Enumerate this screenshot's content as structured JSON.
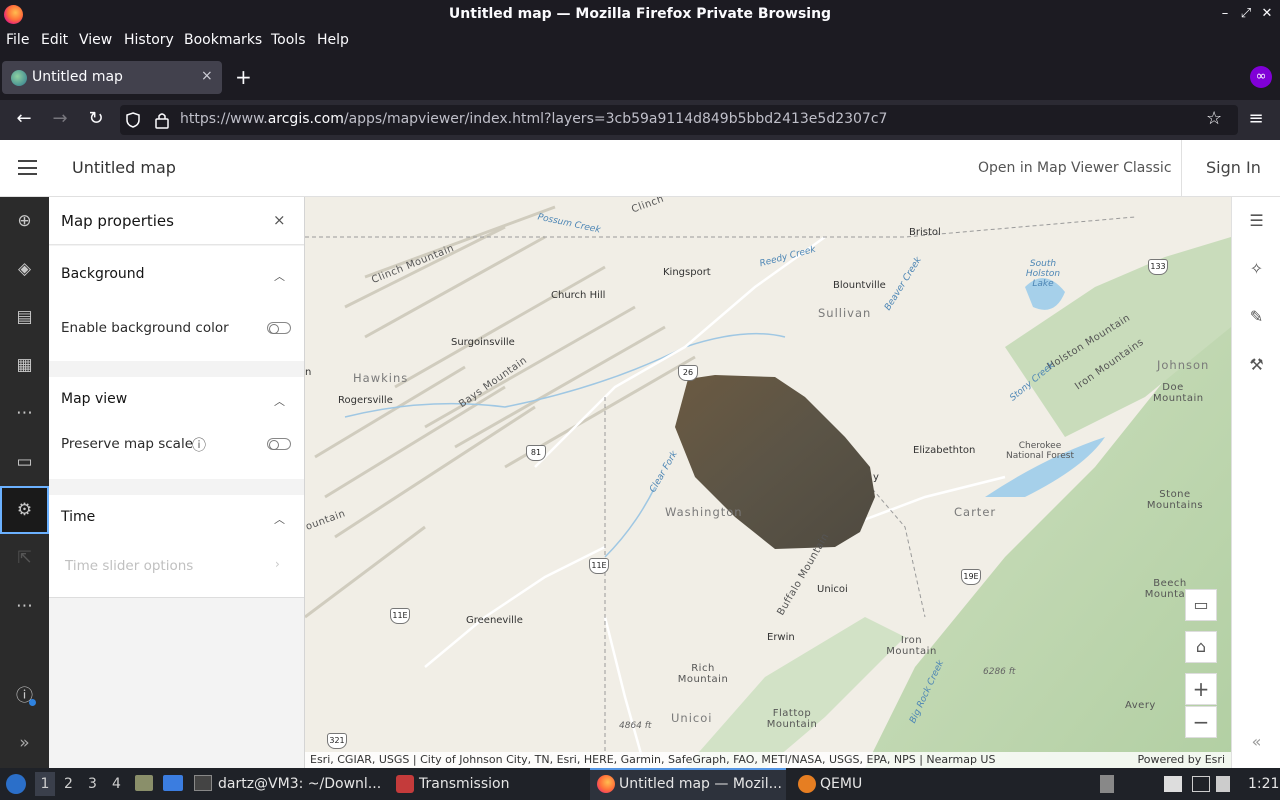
{
  "window": {
    "title": "Untitled map — Mozilla Firefox Private Browsing",
    "controls": [
      "–",
      "⤢",
      "✕"
    ]
  },
  "menubar": [
    "File",
    "Edit",
    "View",
    "History",
    "Bookmarks",
    "Tools",
    "Help"
  ],
  "tab": {
    "label": "Untitled map",
    "close": "×",
    "new_tab": "+"
  },
  "nav": {
    "url_prefix": "https://www.",
    "url_host": "arcgis.com",
    "url_path": "/apps/mapviewer/index.html?layers=3cb59a9114d849b5bbd2413e5d2307c7"
  },
  "app_header": {
    "map_title": "Untitled map",
    "open_classic": "Open in Map Viewer Classic",
    "sign_in": "Sign In"
  },
  "panel": {
    "title": "Map properties",
    "close": "×",
    "sections": {
      "background": {
        "title": "Background",
        "row": "Enable background color",
        "enabled": false
      },
      "map_view": {
        "title": "Map view",
        "row": "Preserve map scale",
        "enabled": false
      },
      "time": {
        "title": "Time",
        "row": "Time slider options"
      }
    }
  },
  "map": {
    "cities": {
      "bristol": "Bristol",
      "kingsport": "Kingsport",
      "church_hill": "Church Hill",
      "blountville": "Blountville",
      "surgoinsville": "Surgoinsville",
      "rogersville": "Rogersville",
      "elizabethton": "Elizabethton",
      "unicoi_town": "Unicoi",
      "erwin": "Erwin",
      "greeneville": "Greeneville"
    },
    "regions": {
      "hawkins": "Hawkins",
      "sullivan": "Sullivan",
      "washington": "Washington",
      "carter": "Carter",
      "johnson": "Johnson",
      "unicoi": "Unicoi"
    },
    "features": {
      "clinch_mtn": "Clinch Mountain",
      "bays_mtn": "Bays Mountain",
      "holston_mtn": "Holston Mountain",
      "iron_mtns": "Iron Mountains",
      "buffalo_mtn": "Buffalo Mountain",
      "doe_mtn": "Doe Mountain",
      "stone_mtns": "Stone Mountains",
      "beech_mtn": "Beech Mountain",
      "iron_mtn": "Iron Mountain",
      "rich_mtn": "Rich Mountain",
      "flattop_mtn": "Flattop Mountain",
      "avery": "Avery",
      "cherokee_nf": "Cherokee National Forest",
      "south_holston": "South Holston Lake",
      "poplar_creek": "Possum Creek",
      "reedy_creek": "Reedy Creek",
      "beaver_creek": "Beaver Creek",
      "knob_creek": "Clear Fork",
      "stony_creek": "Stony Creek",
      "big_rock": "Big Rock Creek",
      "elev1": "6286 ft",
      "elev2": "4864 ft",
      "clinch": "Clinch",
      "mountain_frag": "ountain",
      "mtn_frag2": "n",
      "y_frag": "y"
    },
    "shields": {
      "s133": "133",
      "s26": "26",
      "s81": "81",
      "s11e_a": "11E",
      "s11e_b": "11E",
      "s19e": "19E",
      "s321": "321"
    },
    "attribution": "Esri, CGIAR, USGS | City of Johnson City, TN, Esri, HERE, Garmin, SafeGraph, FAO, METI/NASA, USGS, EPA, NPS | Nearmap US",
    "powered_by": "Powered by Esri"
  },
  "taskbar": {
    "workspaces": [
      "1",
      "2",
      "3",
      "4"
    ],
    "items": {
      "terminal": "dartz@VM3: ~/Downl...",
      "transmission": "Transmission",
      "firefox": "Untitled map — Mozil...",
      "qemu": "QEMU"
    },
    "clock": "1:21"
  }
}
